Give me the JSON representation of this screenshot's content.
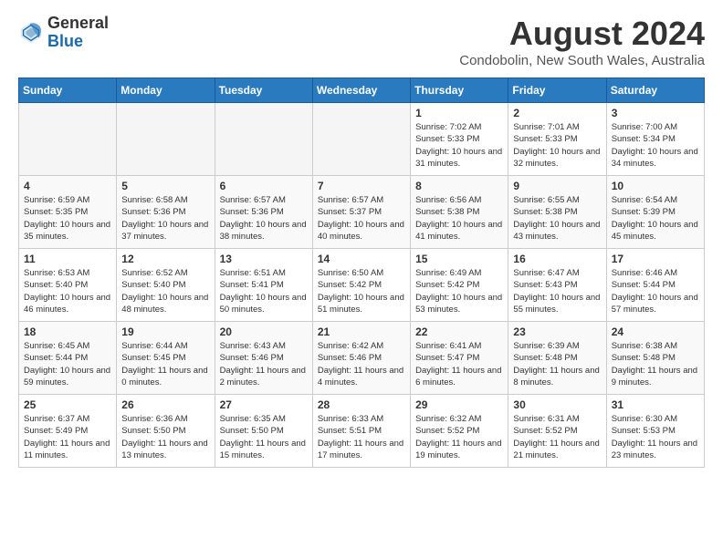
{
  "header": {
    "logo_line1": "General",
    "logo_line2": "Blue",
    "month": "August 2024",
    "location": "Condobolin, New South Wales, Australia"
  },
  "weekdays": [
    "Sunday",
    "Monday",
    "Tuesday",
    "Wednesday",
    "Thursday",
    "Friday",
    "Saturday"
  ],
  "weeks": [
    [
      {
        "day": "",
        "sunrise": "",
        "sunset": "",
        "daylight": "",
        "empty": true
      },
      {
        "day": "",
        "sunrise": "",
        "sunset": "",
        "daylight": "",
        "empty": true
      },
      {
        "day": "",
        "sunrise": "",
        "sunset": "",
        "daylight": "",
        "empty": true
      },
      {
        "day": "",
        "sunrise": "",
        "sunset": "",
        "daylight": "",
        "empty": true
      },
      {
        "day": "1",
        "sunrise": "7:02 AM",
        "sunset": "5:33 PM",
        "daylight": "10 hours and 31 minutes."
      },
      {
        "day": "2",
        "sunrise": "7:01 AM",
        "sunset": "5:33 PM",
        "daylight": "10 hours and 32 minutes."
      },
      {
        "day": "3",
        "sunrise": "7:00 AM",
        "sunset": "5:34 PM",
        "daylight": "10 hours and 34 minutes."
      }
    ],
    [
      {
        "day": "4",
        "sunrise": "6:59 AM",
        "sunset": "5:35 PM",
        "daylight": "10 hours and 35 minutes."
      },
      {
        "day": "5",
        "sunrise": "6:58 AM",
        "sunset": "5:36 PM",
        "daylight": "10 hours and 37 minutes."
      },
      {
        "day": "6",
        "sunrise": "6:57 AM",
        "sunset": "5:36 PM",
        "daylight": "10 hours and 38 minutes."
      },
      {
        "day": "7",
        "sunrise": "6:57 AM",
        "sunset": "5:37 PM",
        "daylight": "10 hours and 40 minutes."
      },
      {
        "day": "8",
        "sunrise": "6:56 AM",
        "sunset": "5:38 PM",
        "daylight": "10 hours and 41 minutes."
      },
      {
        "day": "9",
        "sunrise": "6:55 AM",
        "sunset": "5:38 PM",
        "daylight": "10 hours and 43 minutes."
      },
      {
        "day": "10",
        "sunrise": "6:54 AM",
        "sunset": "5:39 PM",
        "daylight": "10 hours and 45 minutes."
      }
    ],
    [
      {
        "day": "11",
        "sunrise": "6:53 AM",
        "sunset": "5:40 PM",
        "daylight": "10 hours and 46 minutes."
      },
      {
        "day": "12",
        "sunrise": "6:52 AM",
        "sunset": "5:40 PM",
        "daylight": "10 hours and 48 minutes."
      },
      {
        "day": "13",
        "sunrise": "6:51 AM",
        "sunset": "5:41 PM",
        "daylight": "10 hours and 50 minutes."
      },
      {
        "day": "14",
        "sunrise": "6:50 AM",
        "sunset": "5:42 PM",
        "daylight": "10 hours and 51 minutes."
      },
      {
        "day": "15",
        "sunrise": "6:49 AM",
        "sunset": "5:42 PM",
        "daylight": "10 hours and 53 minutes."
      },
      {
        "day": "16",
        "sunrise": "6:47 AM",
        "sunset": "5:43 PM",
        "daylight": "10 hours and 55 minutes."
      },
      {
        "day": "17",
        "sunrise": "6:46 AM",
        "sunset": "5:44 PM",
        "daylight": "10 hours and 57 minutes."
      }
    ],
    [
      {
        "day": "18",
        "sunrise": "6:45 AM",
        "sunset": "5:44 PM",
        "daylight": "10 hours and 59 minutes."
      },
      {
        "day": "19",
        "sunrise": "6:44 AM",
        "sunset": "5:45 PM",
        "daylight": "11 hours and 0 minutes."
      },
      {
        "day": "20",
        "sunrise": "6:43 AM",
        "sunset": "5:46 PM",
        "daylight": "11 hours and 2 minutes."
      },
      {
        "day": "21",
        "sunrise": "6:42 AM",
        "sunset": "5:46 PM",
        "daylight": "11 hours and 4 minutes."
      },
      {
        "day": "22",
        "sunrise": "6:41 AM",
        "sunset": "5:47 PM",
        "daylight": "11 hours and 6 minutes."
      },
      {
        "day": "23",
        "sunrise": "6:39 AM",
        "sunset": "5:48 PM",
        "daylight": "11 hours and 8 minutes."
      },
      {
        "day": "24",
        "sunrise": "6:38 AM",
        "sunset": "5:48 PM",
        "daylight": "11 hours and 9 minutes."
      }
    ],
    [
      {
        "day": "25",
        "sunrise": "6:37 AM",
        "sunset": "5:49 PM",
        "daylight": "11 hours and 11 minutes."
      },
      {
        "day": "26",
        "sunrise": "6:36 AM",
        "sunset": "5:50 PM",
        "daylight": "11 hours and 13 minutes."
      },
      {
        "day": "27",
        "sunrise": "6:35 AM",
        "sunset": "5:50 PM",
        "daylight": "11 hours and 15 minutes."
      },
      {
        "day": "28",
        "sunrise": "6:33 AM",
        "sunset": "5:51 PM",
        "daylight": "11 hours and 17 minutes."
      },
      {
        "day": "29",
        "sunrise": "6:32 AM",
        "sunset": "5:52 PM",
        "daylight": "11 hours and 19 minutes."
      },
      {
        "day": "30",
        "sunrise": "6:31 AM",
        "sunset": "5:52 PM",
        "daylight": "11 hours and 21 minutes."
      },
      {
        "day": "31",
        "sunrise": "6:30 AM",
        "sunset": "5:53 PM",
        "daylight": "11 hours and 23 minutes."
      }
    ]
  ]
}
